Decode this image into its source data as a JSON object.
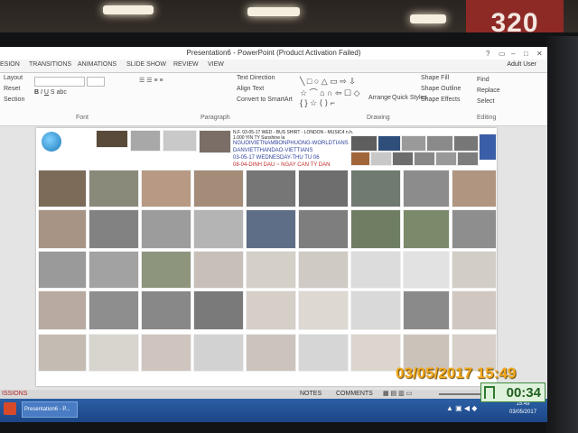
{
  "room_sign": "320",
  "window": {
    "title": "Presentation6 - PowerPoint (Product Activation Failed)"
  },
  "tabs": [
    "ESION",
    "TRANSITIONS",
    "ANIMATIONS",
    "SLIDE SHOW",
    "REVIEW",
    "VIEW"
  ],
  "user": "Adult User",
  "ribbon": {
    "slides_items": [
      "Layout",
      "Reset",
      "Section"
    ],
    "font_label": "Font",
    "paragraph_label": "Paragraph",
    "paragraph_items": [
      "Text Direction",
      "Align Text",
      "Convert to SmartArt"
    ],
    "drawing_label": "Drawing",
    "arrange_label": "Arrange",
    "quick_styles_label": "Quick Styles",
    "shape_items": [
      "Shape Fill",
      "Shape Outline",
      "Shape Effects"
    ],
    "editing_label": "Editing",
    "editing_items": [
      "Find",
      "Replace",
      "Select"
    ]
  },
  "slide": {
    "text_lines": [
      "N.F. 03-05-17 WED - BUS SHIRT - LONDON - MUSIC4 n.h.",
      "1.000 YIN TY Sunshine la",
      "NGUOIVIETNAMBONPHUONG-WORLDTIANS",
      "DANVIETTHANDAO-VIETTIANS",
      "03-05-17 WEDNESDAY-THU TU 06",
      "08-04-DINH DAU ~ NGAY CAN TY DAN"
    ]
  },
  "statusbar": {
    "left": "ISSIONS",
    "notes": "NOTES",
    "comments": "COMMENTS"
  },
  "taskbar": {
    "app": "Presentation6 - P...",
    "clock_time": "15:49",
    "clock_date": "03/05/2017"
  },
  "photo_stamp": "03/05/2017  15:49",
  "presenter_timer": "00:34"
}
